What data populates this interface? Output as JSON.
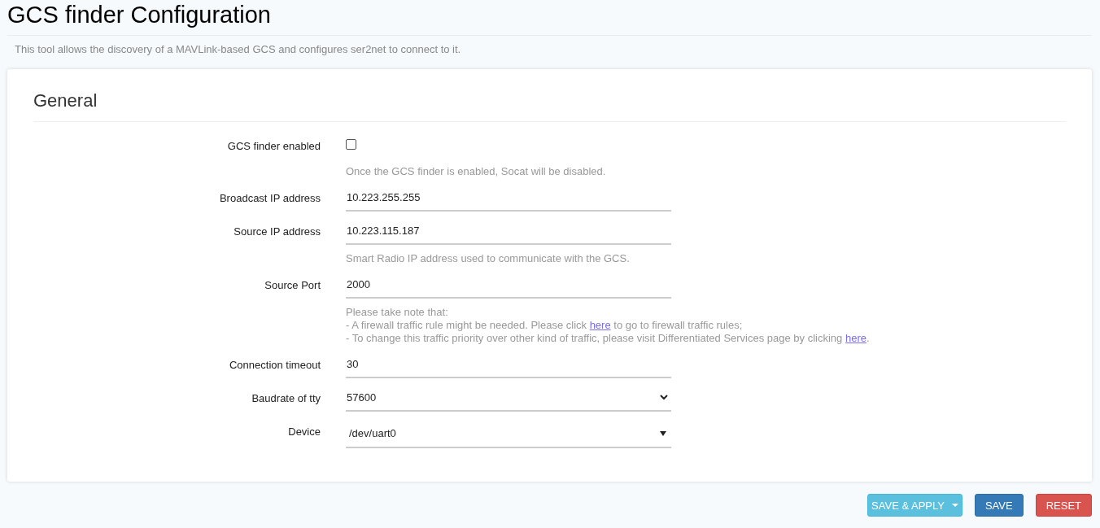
{
  "page": {
    "title": "GCS finder Configuration",
    "description": "This tool allows the discovery of a MAVLink-based GCS and configures ser2net to connect to it."
  },
  "section": {
    "title": "General",
    "fields": [
      {
        "label": "GCS finder enabled",
        "kind": "checkbox",
        "checked": false,
        "help": [
          [
            {
              "kind": "text",
              "text": "Once the GCS finder is enabled, Socat will be disabled."
            }
          ]
        ]
      },
      {
        "label": "Broadcast IP address",
        "kind": "text",
        "value": "10.223.255.255"
      },
      {
        "label": "Source IP address",
        "kind": "text",
        "value": "10.223.115.187",
        "help": [
          [
            {
              "kind": "text",
              "text": "Smart Radio IP address used to communicate with the GCS."
            }
          ]
        ]
      },
      {
        "label": "Source Port",
        "kind": "text",
        "value": "2000",
        "help": [
          [
            {
              "kind": "text",
              "text": "Please take note that:"
            }
          ],
          [
            {
              "kind": "text",
              "text": "- A firewall traffic rule might be needed. Please click "
            },
            {
              "kind": "link",
              "text": "here"
            },
            {
              "kind": "text",
              "text": " to go to firewall traffic rules;"
            }
          ],
          [
            {
              "kind": "text",
              "text": "- To change this traffic priority over other kind of traffic, please visit Differentiated Services page by clicking "
            },
            {
              "kind": "link",
              "text": "here"
            },
            {
              "kind": "text",
              "text": "."
            }
          ]
        ]
      },
      {
        "label": "Connection timeout",
        "kind": "text",
        "value": "30"
      },
      {
        "label": "Baudrate of tty",
        "kind": "select",
        "value": "57600"
      },
      {
        "label": "Device",
        "kind": "dropdown",
        "value": "/dev/uart0"
      }
    ]
  },
  "buttons": [
    {
      "label": "SAVE & APPLY",
      "kind": "apply"
    },
    {
      "label": "SAVE",
      "kind": "save"
    },
    {
      "label": "RESET",
      "kind": "reset"
    }
  ]
}
